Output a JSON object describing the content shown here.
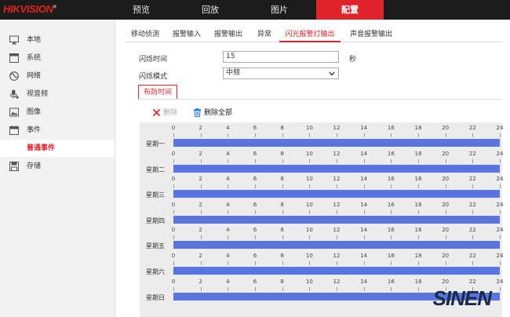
{
  "brand": {
    "logo": "HIKVISION",
    "reg": "®"
  },
  "nav": [
    {
      "label": "预览",
      "active": false
    },
    {
      "label": "回放",
      "active": false
    },
    {
      "label": "图片",
      "active": false
    },
    {
      "label": "配置",
      "active": true
    }
  ],
  "sidebar": [
    {
      "label": "本地",
      "icon": "monitor-icon"
    },
    {
      "label": "系统",
      "icon": "window-icon"
    },
    {
      "label": "网络",
      "icon": "globe-icon"
    },
    {
      "label": "视音频",
      "icon": "microphone-icon"
    },
    {
      "label": "图像",
      "icon": "image-icon"
    },
    {
      "label": "事件",
      "icon": "calendar-icon"
    },
    {
      "label": "普通事件",
      "icon": "",
      "active": true
    },
    {
      "label": "存储",
      "icon": "disk-icon"
    }
  ],
  "tabs": [
    {
      "label": "移动侦测"
    },
    {
      "label": "报警输入"
    },
    {
      "label": "报警输出"
    },
    {
      "label": "异常"
    },
    {
      "label": "闪光报警灯输出",
      "active": true
    },
    {
      "label": "声音报警输出"
    }
  ],
  "form": {
    "flash_time_label": "闪烁时间",
    "flash_time_value": "15",
    "flash_time_unit": "秒",
    "flash_mode_label": "闪烁模式",
    "flash_mode_value": "中频"
  },
  "schedule": {
    "subtab": "布防时间",
    "delete_label": "删除",
    "delete_all_label": "删除全部",
    "ticks": [
      "0",
      "2",
      "4",
      "6",
      "8",
      "10",
      "12",
      "14",
      "16",
      "18",
      "20",
      "22",
      "24"
    ],
    "days": [
      "星期一",
      "星期二",
      "星期三",
      "星期四",
      "星期五",
      "星期六",
      "星期日"
    ],
    "bar_color": "#5a74e0"
  },
  "watermark": "SINEN"
}
